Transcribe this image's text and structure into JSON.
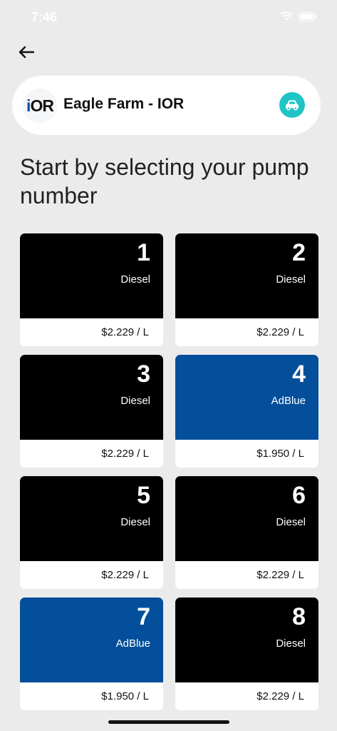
{
  "status_bar": {
    "time": "7:46"
  },
  "header": {
    "back_icon": "arrow-left-icon"
  },
  "station": {
    "logo_text_i": "i",
    "logo_text_or": "OR",
    "name": "Eagle Farm - IOR",
    "vehicle_icon": "car-icon",
    "accent": "#20c4c4"
  },
  "heading": "Start by selecting your pump number",
  "colors": {
    "diesel": "#000000",
    "adblue": "#034f9b",
    "background": "#ebebeb"
  },
  "pumps": [
    {
      "number": "1",
      "fuel": "Diesel",
      "price": "$2.229 / L",
      "kind": "diesel"
    },
    {
      "number": "2",
      "fuel": "Diesel",
      "price": "$2.229 / L",
      "kind": "diesel"
    },
    {
      "number": "3",
      "fuel": "Diesel",
      "price": "$2.229 / L",
      "kind": "diesel"
    },
    {
      "number": "4",
      "fuel": "AdBlue",
      "price": "$1.950 / L",
      "kind": "adblue"
    },
    {
      "number": "5",
      "fuel": "Diesel",
      "price": "$2.229 / L",
      "kind": "diesel"
    },
    {
      "number": "6",
      "fuel": "Diesel",
      "price": "$2.229 / L",
      "kind": "diesel"
    },
    {
      "number": "7",
      "fuel": "AdBlue",
      "price": "$1.950 / L",
      "kind": "adblue"
    },
    {
      "number": "8",
      "fuel": "Diesel",
      "price": "$2.229 / L",
      "kind": "diesel"
    }
  ]
}
